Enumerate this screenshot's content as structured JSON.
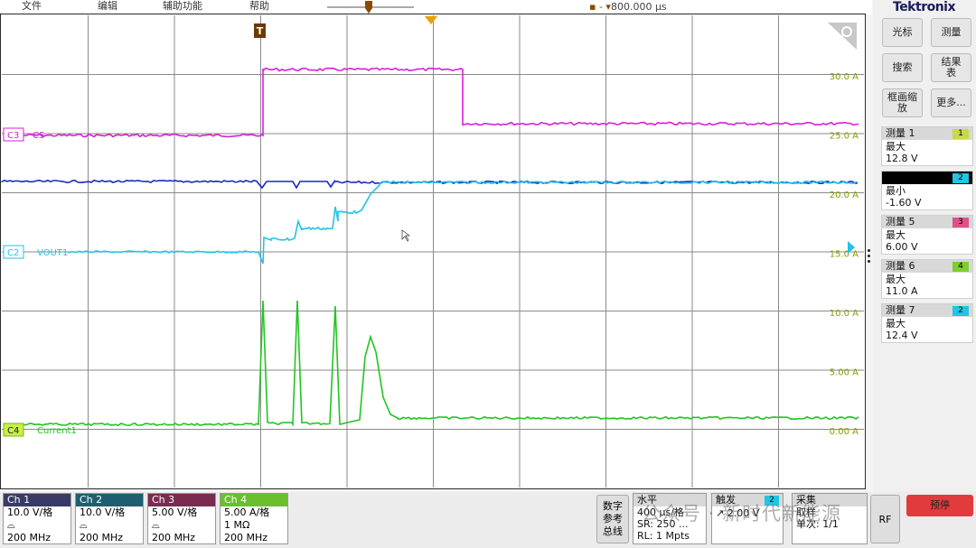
{
  "menu": {
    "file": "文件",
    "edit": "编辑",
    "utilities": "辅助功能",
    "help": "帮助"
  },
  "horizontal_position": "800.000 µs",
  "trigger_marker": "T",
  "brand": "Tektronix",
  "buttons": {
    "cursor": "光标",
    "measure": "测量",
    "search": "搜索",
    "results_table": "结果\n表",
    "waveform_zoom": "框画缩放",
    "more": "更多..."
  },
  "right_scale": {
    "labels": [
      "30.0 A",
      "25.0 A",
      "20.0 A",
      "15.0 A",
      "10.0 A",
      "5.00 A",
      "0.00 A"
    ],
    "color": "#8a9a00"
  },
  "channel_labels": {
    "c3": {
      "tag": "C3",
      "name": "CS",
      "color": "#d81fd8"
    },
    "c2": {
      "tag": "C2",
      "name": "VOUT1",
      "color": "#22c4e6"
    },
    "c4": {
      "tag": "C4",
      "name": "Current1",
      "color": "#22c422"
    }
  },
  "measurements": [
    {
      "title": "测量 1",
      "badge": "1",
      "badge_color": "#c8d84a",
      "stat": "最大",
      "value": "12.8 V",
      "header_dark": false
    },
    {
      "title": "",
      "badge": "2",
      "badge_color": "#22c4e6",
      "stat": "最小",
      "value": "-1.60 V",
      "header_dark": true
    },
    {
      "title": "测量 5",
      "badge": "3",
      "badge_color": "#e0508a",
      "stat": "最大",
      "value": "6.00 V",
      "header_dark": false
    },
    {
      "title": "测量 6",
      "badge": "4",
      "badge_color": "#7ccf2e",
      "stat": "最大",
      "value": "11.0 A",
      "header_dark": false
    },
    {
      "title": "测量 7",
      "badge": "2",
      "badge_color": "#22c4e6",
      "stat": "最大",
      "value": "12.4 V",
      "header_dark": false
    }
  ],
  "channels": [
    {
      "name": "Ch 1",
      "scale": "10.0 V/格",
      "bw": "200 MHz",
      "icon": "probe-icon",
      "color": "#3a3a66",
      "extra": ""
    },
    {
      "name": "Ch 2",
      "scale": "10.0 V/格",
      "bw": "200 MHz",
      "icon": "probe-icon",
      "color": "#1d5f6e",
      "extra": ""
    },
    {
      "name": "Ch 3",
      "scale": "5.00 V/格",
      "bw": "200 MHz",
      "icon": "probe-icon",
      "color": "#7b2b4f",
      "extra": ""
    },
    {
      "name": "Ch 4",
      "scale": "5.00 A/格",
      "bw": "200 MHz",
      "icon": "",
      "color": "#6bbf2e",
      "extra": "1 MΩ"
    }
  ],
  "digital_button": "数字\n参考\n总线",
  "horizontal": {
    "title": "水平",
    "scale": "400 µs/格",
    "sr": "SR: 250 ...",
    "rl": "RL: 1 Mpts"
  },
  "trigger": {
    "title": "触发",
    "badge": "2",
    "level": "2.00 V"
  },
  "acquisition": {
    "title": "采集",
    "mode": "取样",
    "count": "单次: 1/1"
  },
  "rf_button": "RF",
  "stop_button": "预停",
  "watermark": "公众号 · 新时代新能源"
}
